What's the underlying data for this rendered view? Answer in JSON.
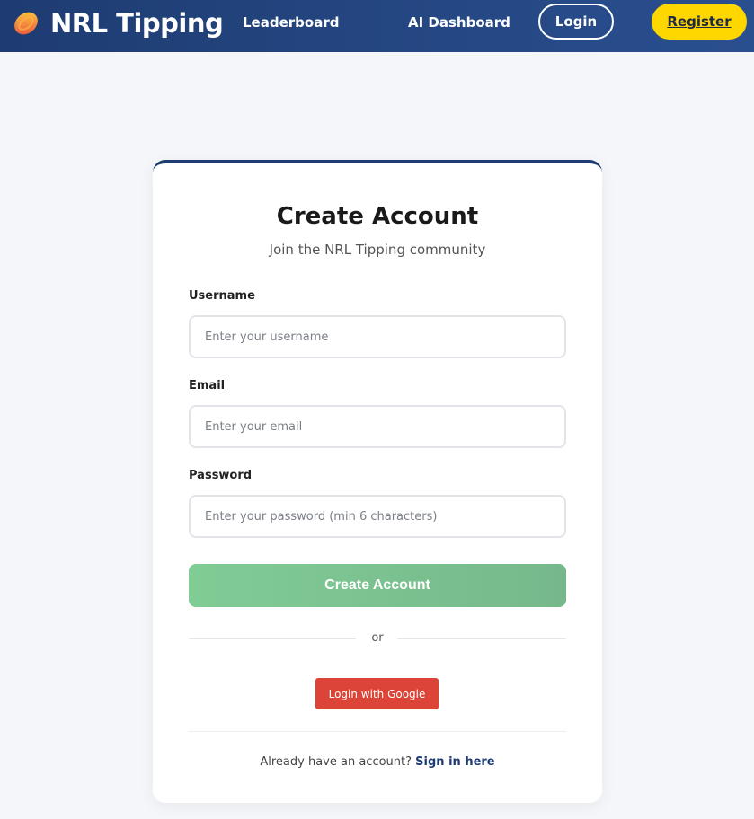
{
  "header": {
    "brand": "NRL Tipping",
    "brand_icon": "football-icon",
    "nav_leaderboard": "Leaderboard",
    "nav_ai_dashboard": "AI Dashboard",
    "login_button": "Login",
    "register_button": "Register"
  },
  "form": {
    "title": "Create Account",
    "subtitle": "Join the NRL Tipping community",
    "username_label": "Username",
    "username_placeholder": "Enter your username",
    "email_label": "Email",
    "email_placeholder": "Enter your email",
    "password_label": "Password",
    "password_placeholder": "Enter your password (min 6 characters)",
    "submit_button": "Create Account",
    "divider_text": "or",
    "google_button": "Login with Google",
    "footer_prompt": "Already have an account?",
    "footer_link": "Sign in here"
  },
  "colors": {
    "header_bg": "#1e3c72",
    "register_bg": "#ffd700",
    "submit_bg": "#80cc95",
    "google_bg": "#db4437"
  }
}
